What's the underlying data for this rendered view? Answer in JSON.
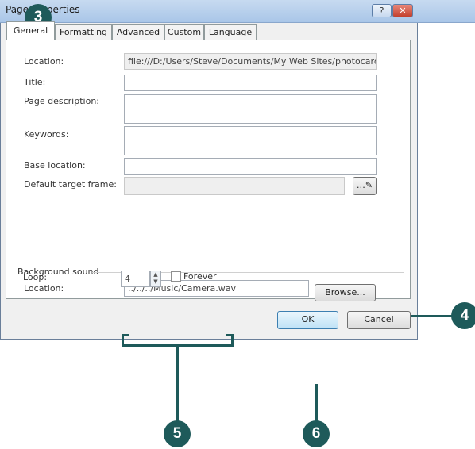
{
  "dialog": {
    "title": "Page Properties",
    "help_label": "?",
    "close_label": "✕"
  },
  "tabs": [
    {
      "label": "General",
      "active": true
    },
    {
      "label": "Formatting",
      "active": false
    },
    {
      "label": "Advanced",
      "active": false
    },
    {
      "label": "Custom",
      "active": false
    },
    {
      "label": "Language",
      "active": false
    }
  ],
  "general": {
    "location_label": "Location:",
    "location_value": "file:///D:/Users/Steve/Documents/My Web Sites/photocards",
    "title_label": "Title:",
    "title_value": "",
    "description_label": "Page description:",
    "description_value": "",
    "keywords_label": "Keywords:",
    "keywords_value": "",
    "base_label": "Base location:",
    "base_value": "",
    "target_label": "Default target frame:",
    "target_value": ""
  },
  "background_sound": {
    "group_label": "Background sound",
    "location_label": "Location:",
    "location_value": "../../../Music/Camera.wav",
    "browse_label": "Browse...",
    "loop_label": "Loop:",
    "loop_value": "4",
    "forever_label": "Forever",
    "forever_checked": false
  },
  "buttons": {
    "ok_label": "OK",
    "cancel_label": "Cancel"
  },
  "callouts": {
    "c3": "3",
    "c4": "4",
    "c5": "5",
    "c6": "6"
  },
  "colors": {
    "callout": "#1e5a5a",
    "titlebar": "#a9c6e8",
    "close_button": "#c3402d"
  }
}
